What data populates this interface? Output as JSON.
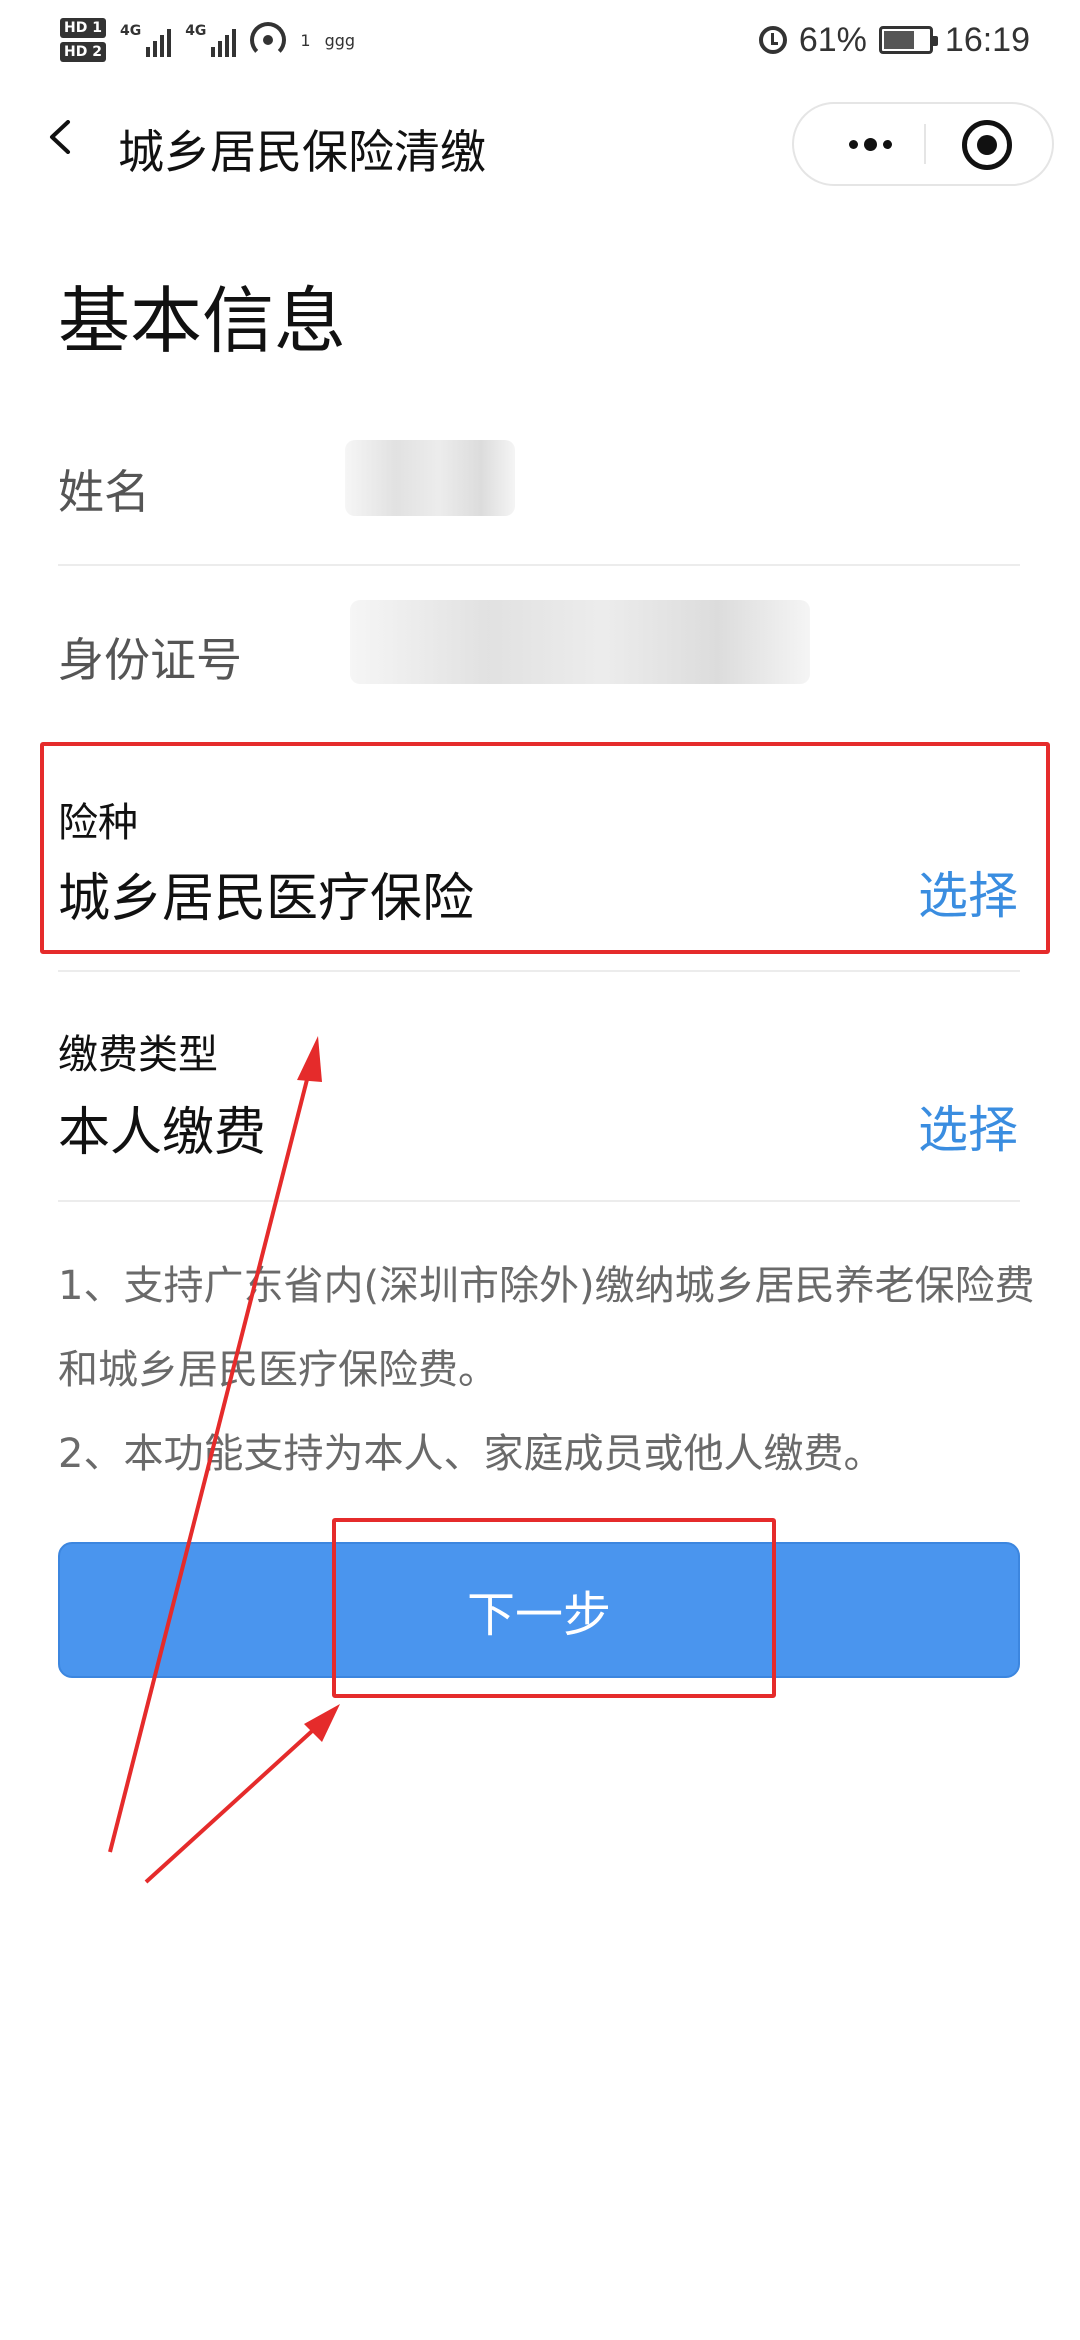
{
  "status_bar": {
    "hd_labels": [
      "HD 1",
      "HD 2"
    ],
    "network": [
      "4G",
      "4G"
    ],
    "wifi_count": "1",
    "extra": "ggg",
    "battery_percent": "61%",
    "time": "16:19"
  },
  "nav": {
    "title": "城乡居民保险清缴",
    "back_icon": "chevron-left-icon",
    "more_icon": "more-dots-icon",
    "close_icon": "target-circle-icon"
  },
  "page": {
    "heading": "基本信息",
    "name_label": "姓名",
    "id_label": "身份证号",
    "insurance": {
      "label": "险种",
      "value": "城乡居民医疗保险",
      "action": "选择"
    },
    "payment": {
      "label": "缴费类型",
      "value": "本人缴费",
      "action": "选择"
    },
    "notes": [
      "1、支持广东省内(深圳市除外)缴纳城乡居民养老保险费和城乡居民医疗保险费。",
      "2、本功能支持为本人、家庭成员或他人缴费。"
    ],
    "next_button": "下一步"
  },
  "colors": {
    "accent": "#4a95ee",
    "link": "#3a8de0",
    "annotation": "#e52b2b"
  }
}
